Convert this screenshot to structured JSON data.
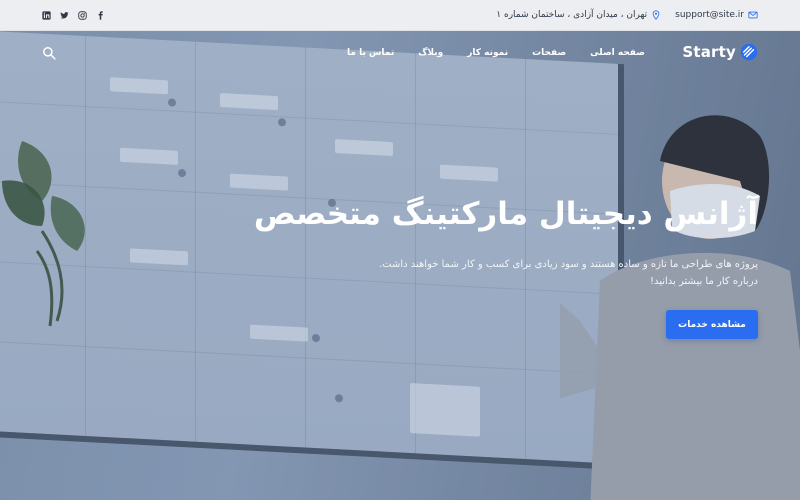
{
  "topbar": {
    "email": "support@site.ir",
    "address": "تهران ، میدان آزادی ، ساختمان شماره ۱",
    "social": [
      "facebook-icon",
      "instagram-icon",
      "twitter-icon",
      "linkedin-icon"
    ]
  },
  "nav": {
    "logo": "Starty",
    "items": [
      "صفحه اصلی",
      "صفحات",
      "نمونه کار",
      "وبلاگ",
      "تماس با ما"
    ]
  },
  "hero": {
    "title": "آژانس دیجیتال مارکتینگ متخصص",
    "description": "پروژه های طراحی ما تازه و ساده هستند و سود زیادی برای کسب و کار شما خواهند داشت. درباره کار ما بیشتر بدانید!",
    "cta": "مشاهده خدمات"
  },
  "colors": {
    "accent": "#2b6df0",
    "topbar_bg": "#eceef1"
  }
}
